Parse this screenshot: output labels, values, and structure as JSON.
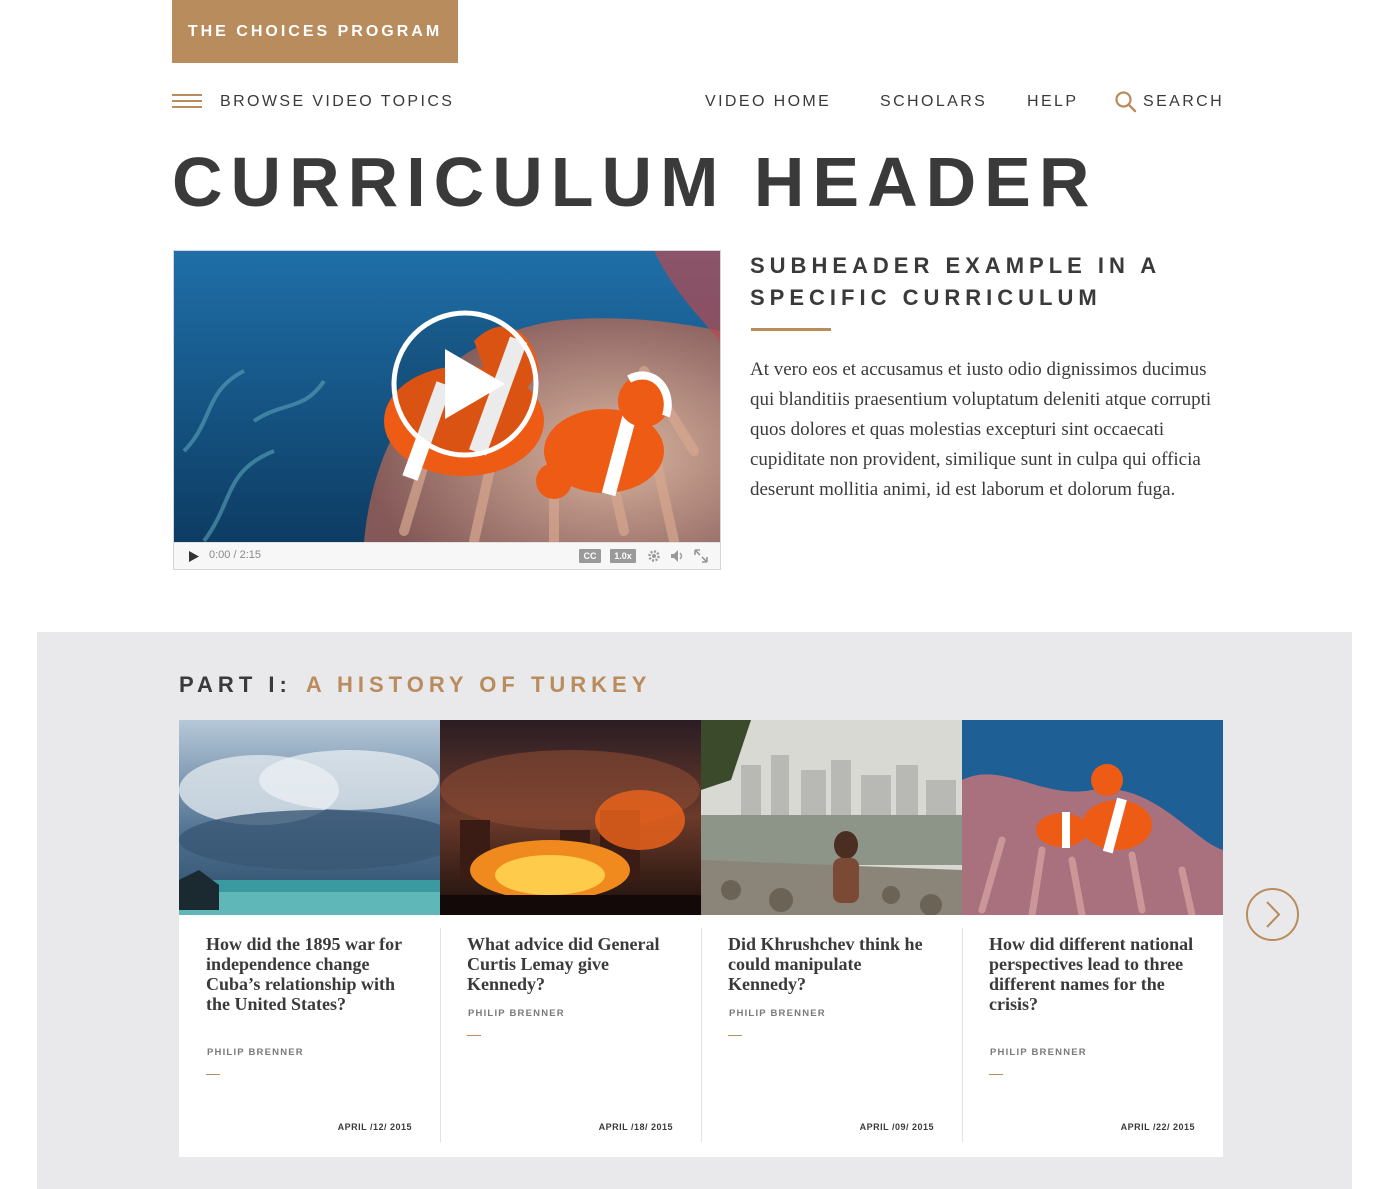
{
  "brand": {
    "label": "THE CHOICES PROGRAM"
  },
  "nav": {
    "browse": "BROWSE VIDEO TOPICS",
    "video_home": "VIDEO HOME",
    "scholars": "SCHOLARS",
    "help": "HELP",
    "search": "SEARCH"
  },
  "page": {
    "title": "CURRICULUM HEADER",
    "subheader": "SUBHEADER EXAMPLE IN A SPECIFIC CURRICULUM",
    "body": "At vero eos et accusamus et iusto odio dignissimos ducimus qui blanditiis praesentium voluptatum deleniti atque corrupti quos dolores et quas molestias excepturi sint occaecati cupiditate non provident, similique sunt in culpa qui officia deserunt mollitia animi, id est laborum et dolorum fuga."
  },
  "video": {
    "time": "0:00 / 2:15",
    "cc_label": "CC",
    "speed_label": "1.0x"
  },
  "section": {
    "part": "PART I:",
    "topic": "A HISTORY OF TURKEY"
  },
  "cards": [
    {
      "title": "How did the 1895 war for independence change Cuba’s relationship with the United States?",
      "author": "PHILIP BRENNER",
      "date": "APRIL /12/ 2015",
      "image": "stormy-sea"
    },
    {
      "title": "What advice did General Curtis Lemay give Kennedy?",
      "author": "PHILIP BRENNER",
      "date": "APRIL /18/ 2015",
      "image": "fire"
    },
    {
      "title": "Did Khrushchev think he could manipulate Kennedy?",
      "author": "PHILIP BRENNER",
      "date": "APRIL /09/ 2015",
      "image": "city-shore"
    },
    {
      "title": "How did different national perspectives lead to three different names for the crisis?",
      "author": "PHILIP BRENNER",
      "date": "APRIL /22/ 2015",
      "image": "clownfish"
    }
  ],
  "colors": {
    "accent": "#b98c5d",
    "text": "#3a3a3a",
    "section_bg": "#e9e9eb"
  }
}
